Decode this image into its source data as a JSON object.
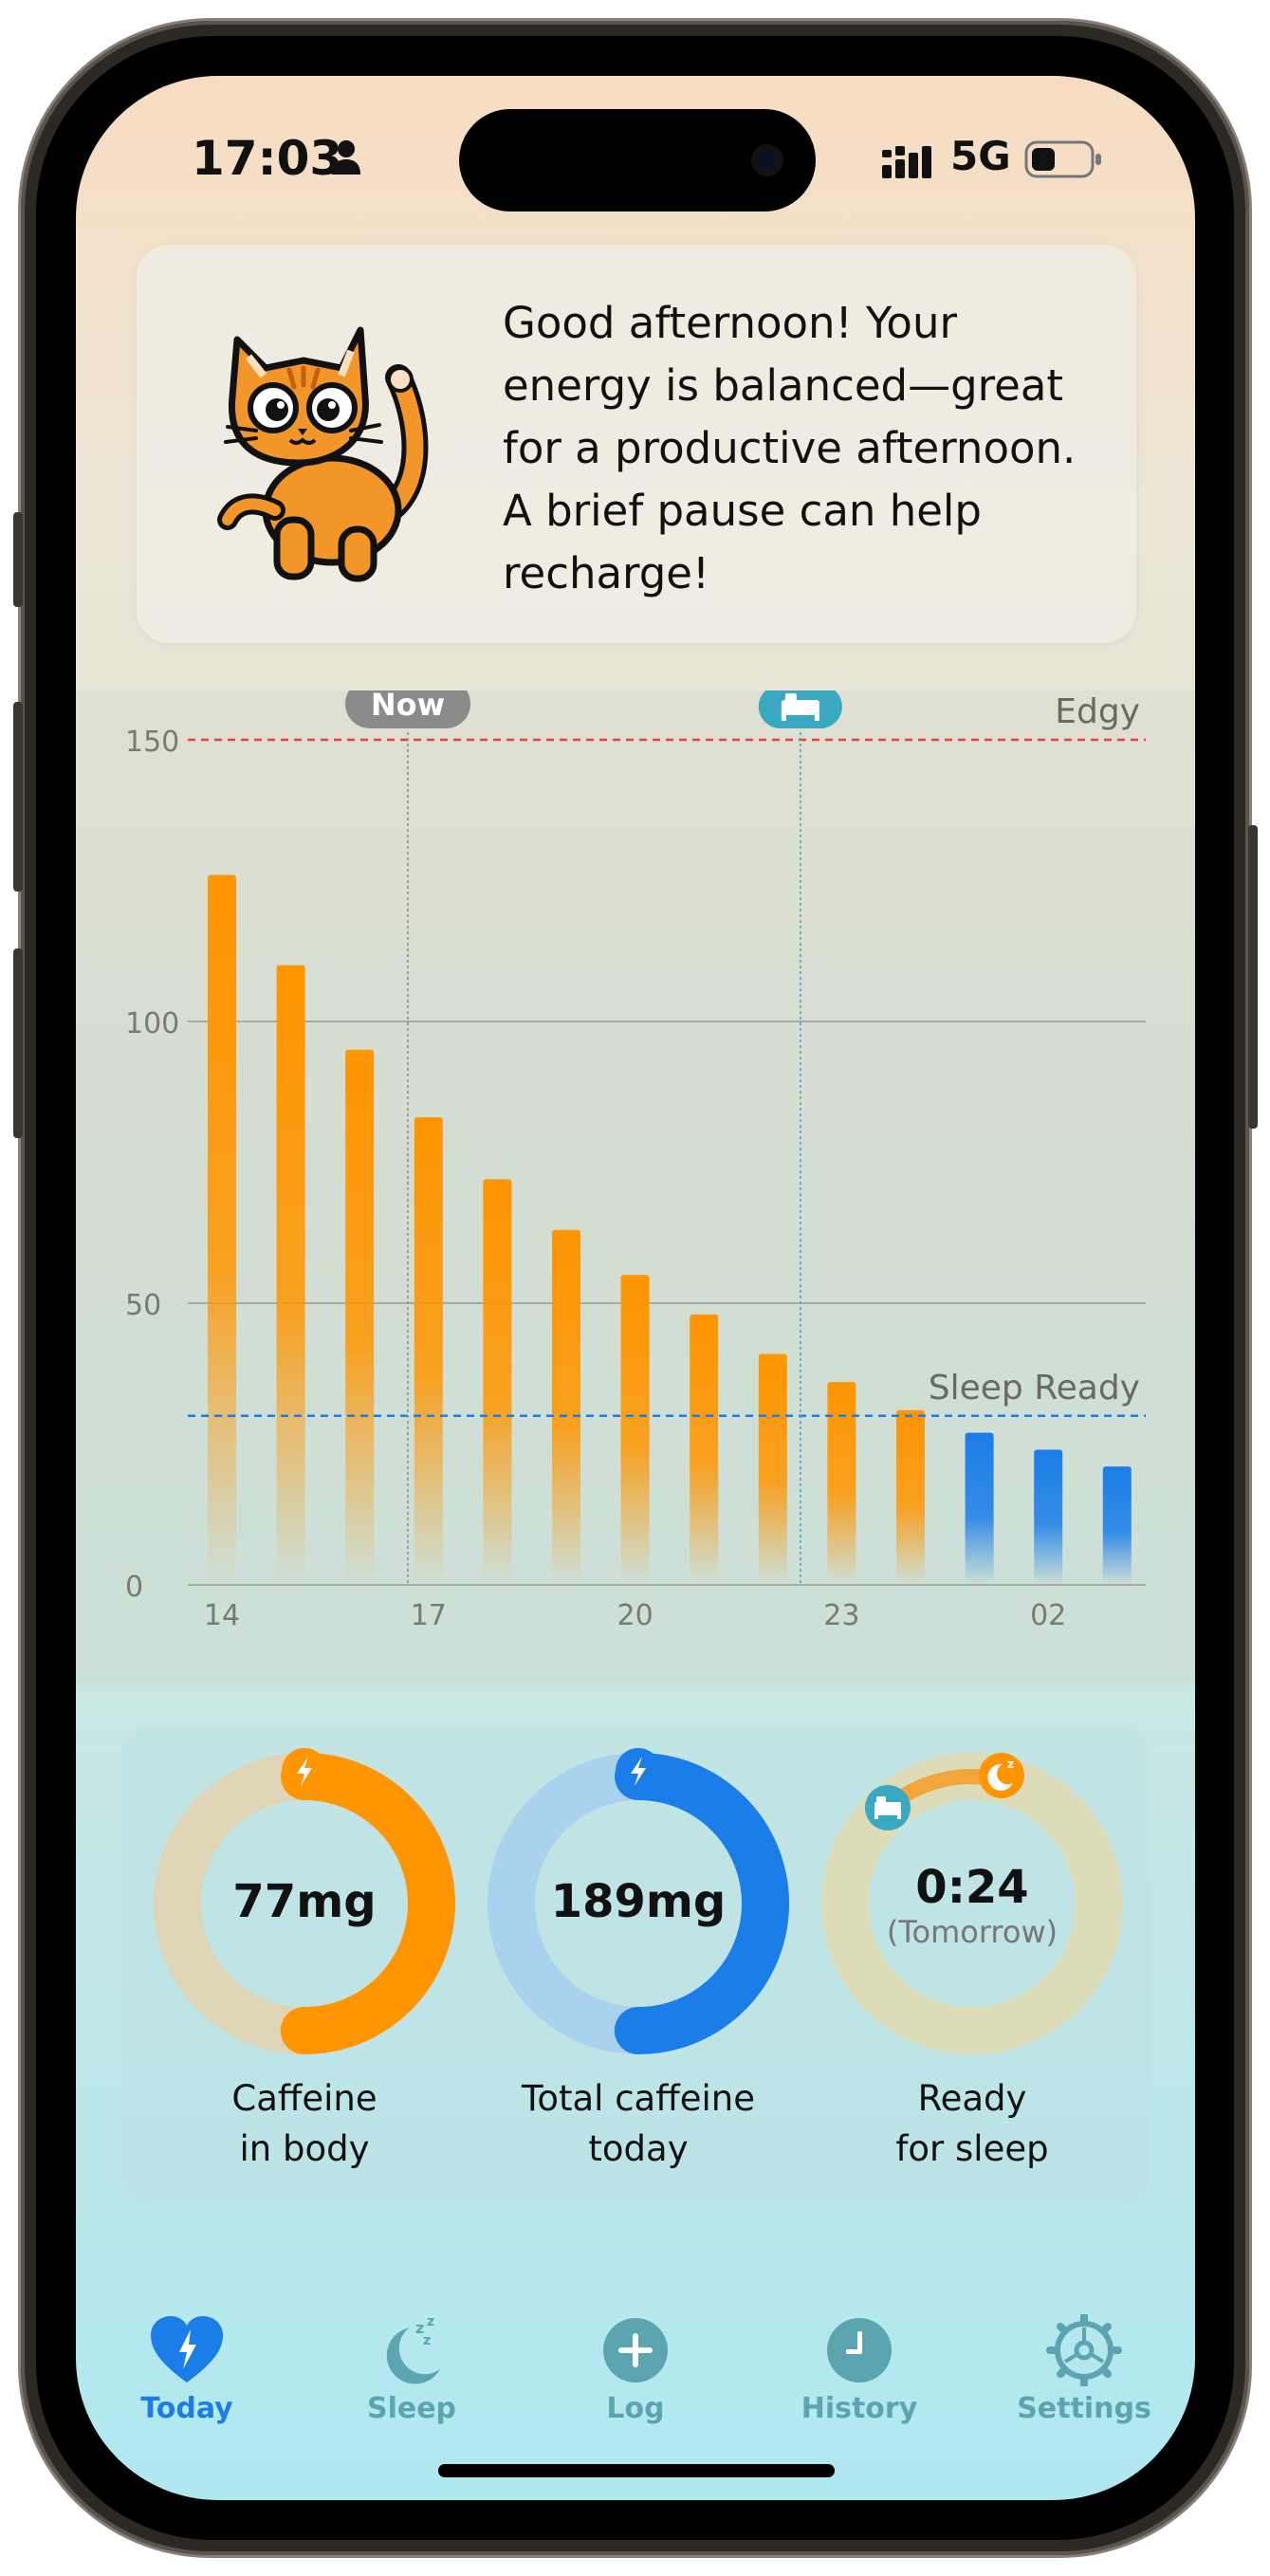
{
  "status_bar": {
    "time": "17:03",
    "network": "5G"
  },
  "banner": {
    "message": "Good afternoon! Your energy is balanced—great for a productive afternoon. A brief pause can help recharge!"
  },
  "chart": {
    "now_label": "Now",
    "threshold_high_label": "Edgy",
    "threshold_low_label": "Sleep Ready",
    "colors": {
      "awake": "#ff9500",
      "sleep": "#1a7de8",
      "edgy_line": "#e8403a",
      "sleep_line": "#1a7de8",
      "now_tag": "#8a8a8a",
      "bed_tag": "#3aa8c0"
    }
  },
  "chart_data": {
    "type": "bar",
    "x_ticks": [
      "14",
      "17",
      "20",
      "23",
      "02"
    ],
    "y_ticks": [
      "0",
      "50",
      "100",
      "150"
    ],
    "ylim": [
      0,
      160
    ],
    "values": [
      126,
      110,
      95,
      83,
      72,
      63,
      55,
      48,
      41,
      36,
      31,
      27,
      24,
      21
    ],
    "bar_series": [
      "awake",
      "awake",
      "awake",
      "awake",
      "awake",
      "awake",
      "awake",
      "awake",
      "awake",
      "awake",
      "awake",
      "sleep",
      "sleep",
      "sleep"
    ],
    "threshold_high": 150,
    "threshold_low": 30,
    "now_index": 2.7,
    "bed_index": 8.4
  },
  "stats": {
    "caffeine_in_body": {
      "value": "77",
      "unit": "mg",
      "label_1": "Caffeine",
      "label_2": "in body",
      "fraction": 0.5
    },
    "total_today": {
      "value": "189",
      "unit": "mg",
      "label_1": "Total caffeine",
      "label_2": "today",
      "fraction": 0.5
    },
    "ready_for_sleep": {
      "value": "0:24",
      "sub": "(Tomorrow)",
      "label_1": "Ready",
      "label_2": "for sleep",
      "fraction": 0.08
    }
  },
  "tabs": [
    {
      "label": "Today",
      "icon": "heart-bolt-icon",
      "active": true
    },
    {
      "label": "Sleep",
      "icon": "moon-zzz-icon",
      "active": false
    },
    {
      "label": "Log",
      "icon": "plus-circle-icon",
      "active": false
    },
    {
      "label": "History",
      "icon": "clock-icon",
      "active": false
    },
    {
      "label": "Settings",
      "icon": "gear-icon",
      "active": false
    }
  ]
}
